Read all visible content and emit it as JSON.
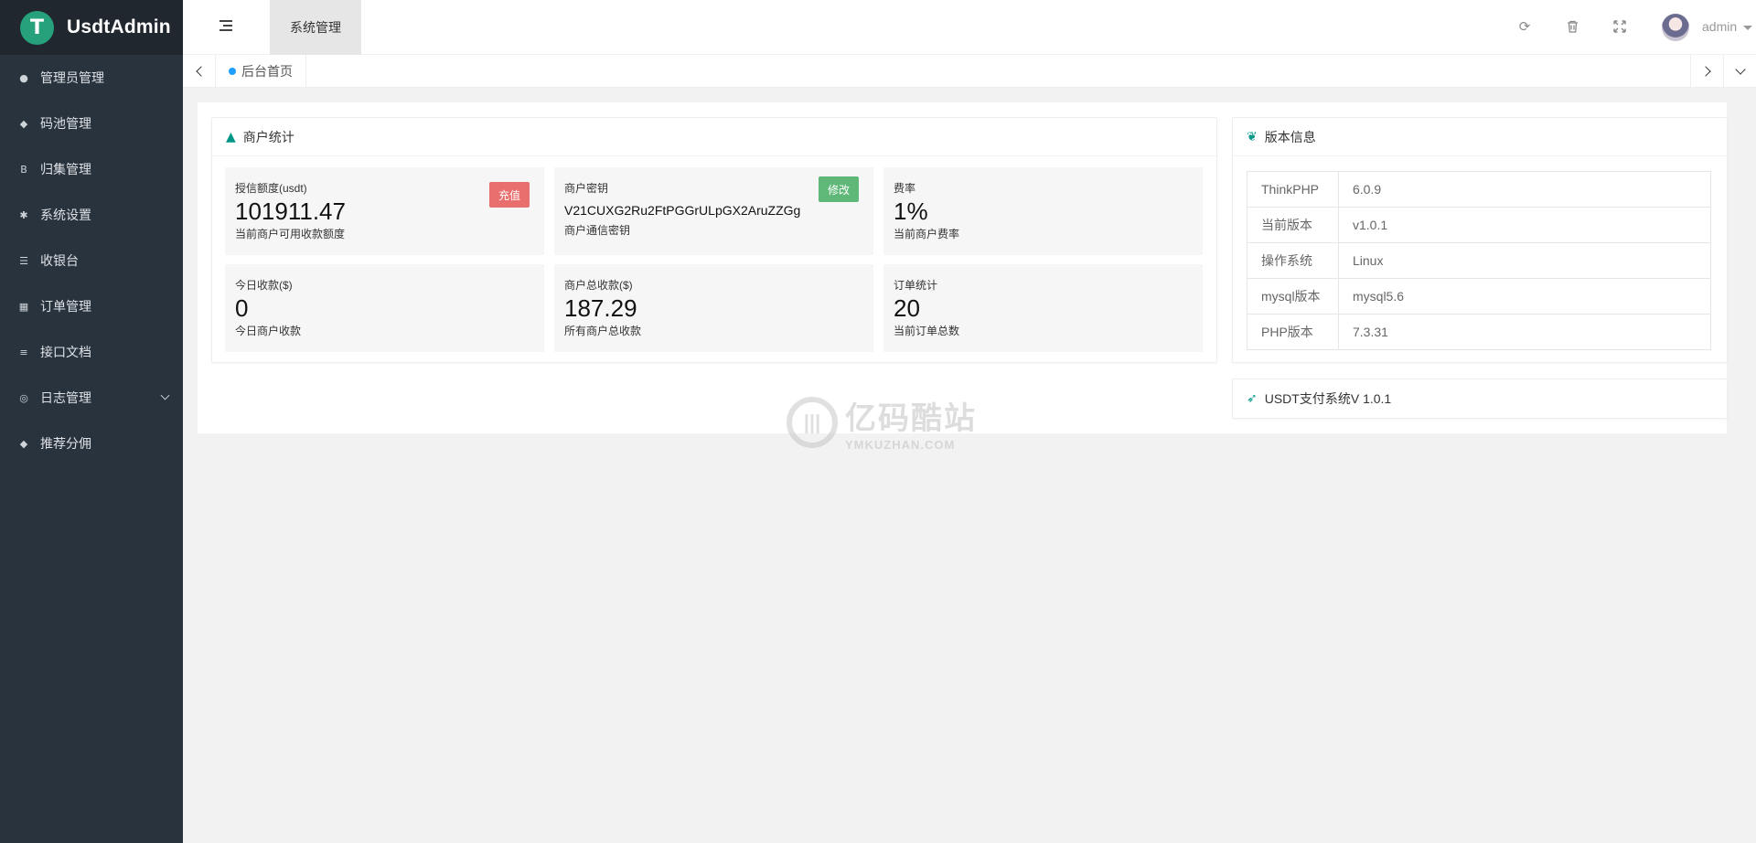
{
  "brand": {
    "name": "UsdtAdmin",
    "logo_glyph": "T"
  },
  "sidebar": {
    "items": [
      {
        "label": "管理员管理",
        "icon": "user-icon",
        "glyph": "●"
      },
      {
        "label": "码池管理",
        "icon": "android-icon",
        "glyph": "◆"
      },
      {
        "label": "归集管理",
        "icon": "bitcoin-icon",
        "glyph": "B"
      },
      {
        "label": "系统设置",
        "icon": "asterisk-icon",
        "glyph": "✱"
      },
      {
        "label": "收银台",
        "icon": "list-icon",
        "glyph": "☰"
      },
      {
        "label": "订单管理",
        "icon": "calculator-icon",
        "glyph": "▦"
      },
      {
        "label": "接口文档",
        "icon": "align-left-icon",
        "glyph": "≡"
      },
      {
        "label": "日志管理",
        "icon": "log-icon",
        "glyph": "◎"
      },
      {
        "label": "推荐分佣",
        "icon": "android-icon",
        "glyph": "◆"
      }
    ]
  },
  "header": {
    "active_tab": "系统管理",
    "user_name": "admin"
  },
  "tabbar": {
    "home_tab": "后台首页"
  },
  "merchant": {
    "title": "商户统计",
    "stats": [
      {
        "label": "授信额度(usdt)",
        "value": "101911.47",
        "sub": "当前商户可用收款额度",
        "badge": "充值",
        "badge_color": "#e96f6f"
      },
      {
        "label": "商户密钥",
        "value": "V21CUXG2Ru2FtPGGrULpGX2AruZZGg",
        "sub": "商户通信密钥",
        "badge": "修改",
        "badge_color": "#5fb878"
      },
      {
        "label": "费率",
        "value": "1%",
        "sub": "当前商户费率"
      },
      {
        "label": "今日收款($)",
        "value": "0",
        "sub": "今日商户收款"
      },
      {
        "label": "商户总收款($)",
        "value": "187.29",
        "sub": "所有商户总收款"
      },
      {
        "label": "订单统计",
        "value": "20",
        "sub": "当前订单总数"
      }
    ]
  },
  "version": {
    "title": "版本信息",
    "rows": [
      {
        "key": "ThinkPHP",
        "value": "6.0.9"
      },
      {
        "key": "当前版本",
        "value": "v1.0.1"
      },
      {
        "key": "操作系统",
        "value": "Linux"
      },
      {
        "key": "mysql版本",
        "value": "mysql5.6"
      },
      {
        "key": "PHP版本",
        "value": "7.3.31"
      }
    ]
  },
  "system_card": {
    "title": "USDT支付系统V 1.0.1"
  },
  "watermark": {
    "main": "亿码酷站",
    "sub": "YMKUZHAN.COM"
  },
  "colors": {
    "sidebar": "#28333e",
    "logo_bg": "#20272f",
    "accent": "#009688",
    "tab_dot": "#1e9fff"
  }
}
